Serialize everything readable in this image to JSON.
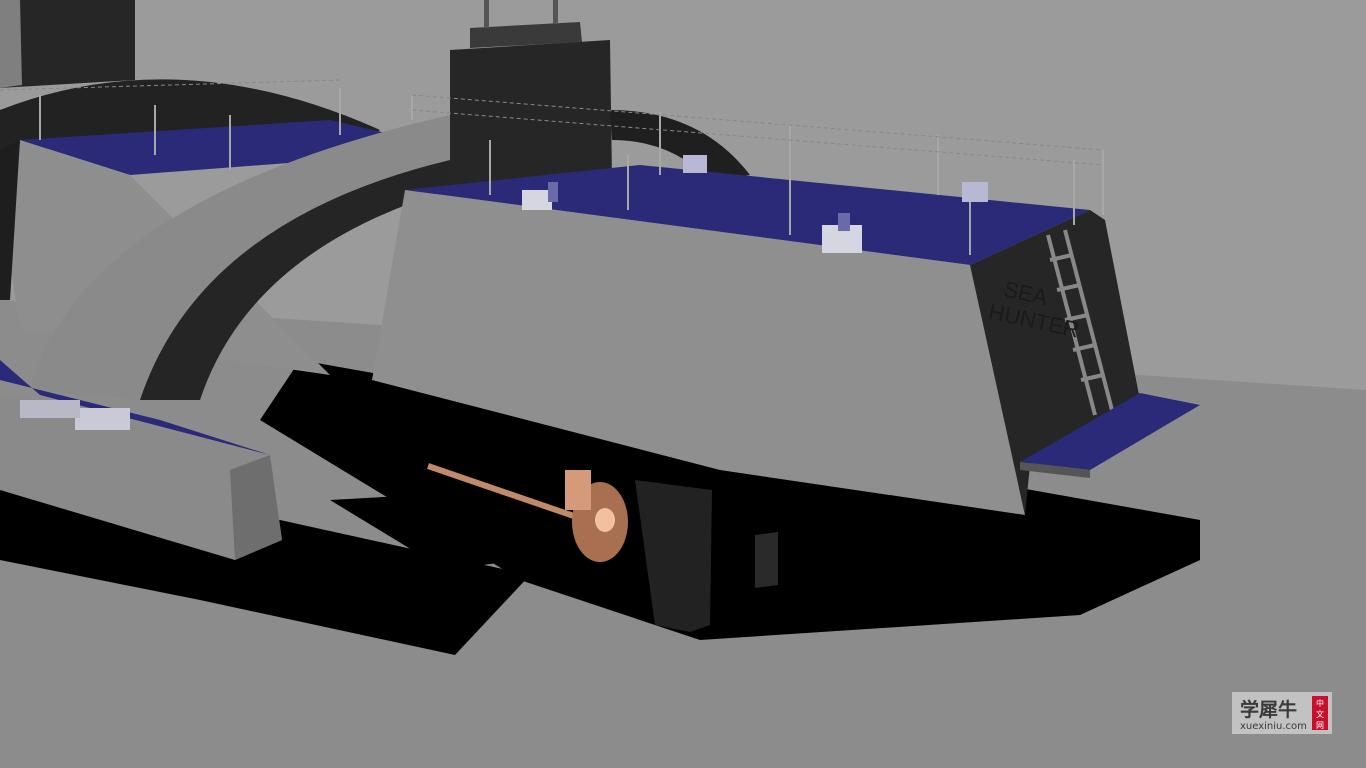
{
  "scene": {
    "hull_name_line1": "SEA",
    "hull_name_line2": "HUNTER"
  },
  "watermark": {
    "title": "学犀牛",
    "url": "xuexiniu.com",
    "tag": [
      "中",
      "文",
      "网"
    ]
  },
  "colors": {
    "background": "#9a9a9a",
    "floor": "#8d8d8d",
    "hull_side": "#8f8f8f",
    "hull_dark": "#262626",
    "deck": "#2a2a78",
    "propeller": "#c08a6a",
    "brand_red": "#c8102e"
  }
}
